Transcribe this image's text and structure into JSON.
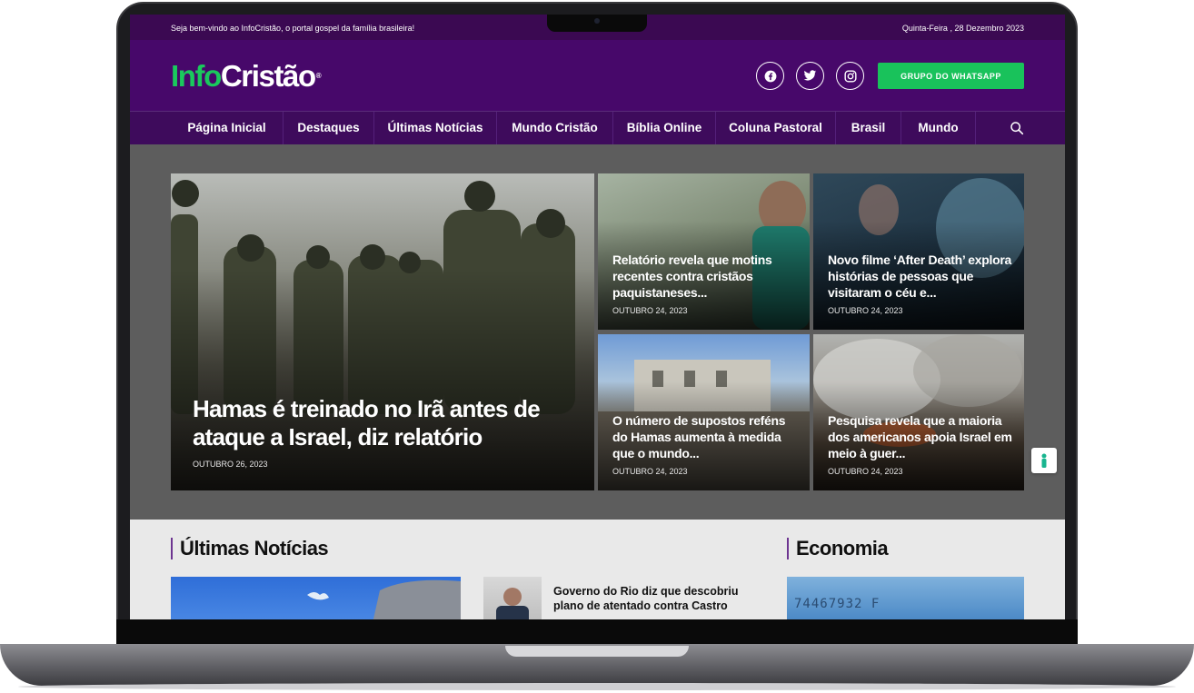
{
  "topbar": {
    "welcome": "Seja bem-vindo ao InfoCristão, o portal gospel da família brasileira!",
    "date": "Quinta-Feira , 28 Dezembro 2023"
  },
  "header": {
    "logo_info": "Info",
    "logo_cristao": "Cristão",
    "logo_reg": "®",
    "whatsapp_label": "GRUPO DO WHATSAPP"
  },
  "nav": {
    "items": [
      "Página Inicial",
      "Destaques",
      "Últimas Notícias",
      "Mundo Cristão",
      "Bíblia Online",
      "Coluna Pastoral",
      "Brasil",
      "Mundo"
    ]
  },
  "hero": {
    "main": {
      "title": "Hamas é treinado no Irã antes de ataque a Israel, diz relatório",
      "date": "OUTUBRO 26, 2023"
    },
    "cards": [
      {
        "title": "Relatório revela que motins recentes contra cristãos paquistaneses...",
        "date": "OUTUBRO 24, 2023"
      },
      {
        "title": "Novo filme ‘After Death’ explora histórias de pessoas que visitaram o céu e...",
        "date": "OUTUBRO 24, 2023"
      },
      {
        "title": "O número de supostos reféns do Hamas aumenta à medida que o mundo...",
        "date": "OUTUBRO 24, 2023"
      },
      {
        "title": "Pesquisa revela que a maioria dos americanos apoia Israel em meio à guer...",
        "date": "OUTUBRO 24, 2023"
      }
    ]
  },
  "sections": {
    "latest_title": "Últimas Notícias",
    "economy_title": "Economia",
    "latest_news_title": "Governo do Rio diz que descobriu plano de atentado contra Castro",
    "banknote_text": "74467932 F"
  },
  "colors": {
    "brand_purple": "#47086a",
    "nav_purple": "#3e0b5c",
    "brand_green": "#1ac95d"
  },
  "icons": [
    "facebook-icon",
    "twitter-icon",
    "instagram-icon",
    "search-icon",
    "accessibility-icon"
  ]
}
